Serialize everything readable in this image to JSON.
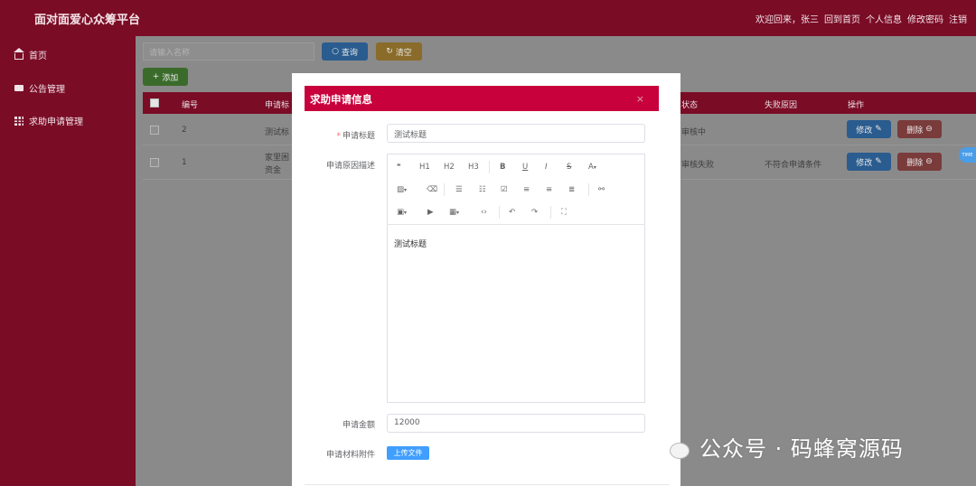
{
  "header": {
    "title": "面对面爱心众筹平台",
    "welcome": "欢迎回来，张三",
    "links": [
      "回到首页",
      "个人信息",
      "修改密码",
      "注销"
    ]
  },
  "sidebar": {
    "items": [
      {
        "label": "首页",
        "icon": "home-icon"
      },
      {
        "label": "公告管理",
        "icon": "message-icon"
      },
      {
        "label": "求助申请管理",
        "icon": "grid-icon"
      }
    ]
  },
  "toolbar": {
    "search_placeholder": "请输入名称",
    "query_label": "查询",
    "clear_label": "清空",
    "add_label": "添加"
  },
  "table": {
    "columns": [
      "编号",
      "申请标",
      "状态",
      "失败原因",
      "操作"
    ],
    "rows": [
      {
        "id": "2",
        "title": "测试标",
        "status": "审核中",
        "reason": "",
        "edit": "修改",
        "delete": "删除"
      },
      {
        "id": "1",
        "title": "家里困",
        "title_line2": "资金",
        "status": "审核失败",
        "reason": "不符合申请条件",
        "edit": "修改",
        "delete": "删除"
      }
    ]
  },
  "dialog": {
    "title": "求助申请信息",
    "close": "×",
    "fields": {
      "title_label": "申请标题",
      "title_value": "测试标题",
      "desc_label": "申请原因描述",
      "desc_content": "测试标题",
      "amount_label": "申请金额",
      "amount_value": "12000",
      "attachment_label": "申请材料附件",
      "upload_label": "上传文件"
    },
    "editor_toolbar": {
      "h1": "H1",
      "h2": "H2",
      "h3": "H3",
      "bold": "B",
      "underline": "U",
      "italic": "I",
      "strike": "S",
      "font_color": "A"
    }
  },
  "watermark": "公众号 · 码蜂窝源码",
  "float_badge": "TIME",
  "colors": {
    "brand": "#7a0c26",
    "dialog_header": "#c8003c",
    "primary": "#409eff"
  }
}
